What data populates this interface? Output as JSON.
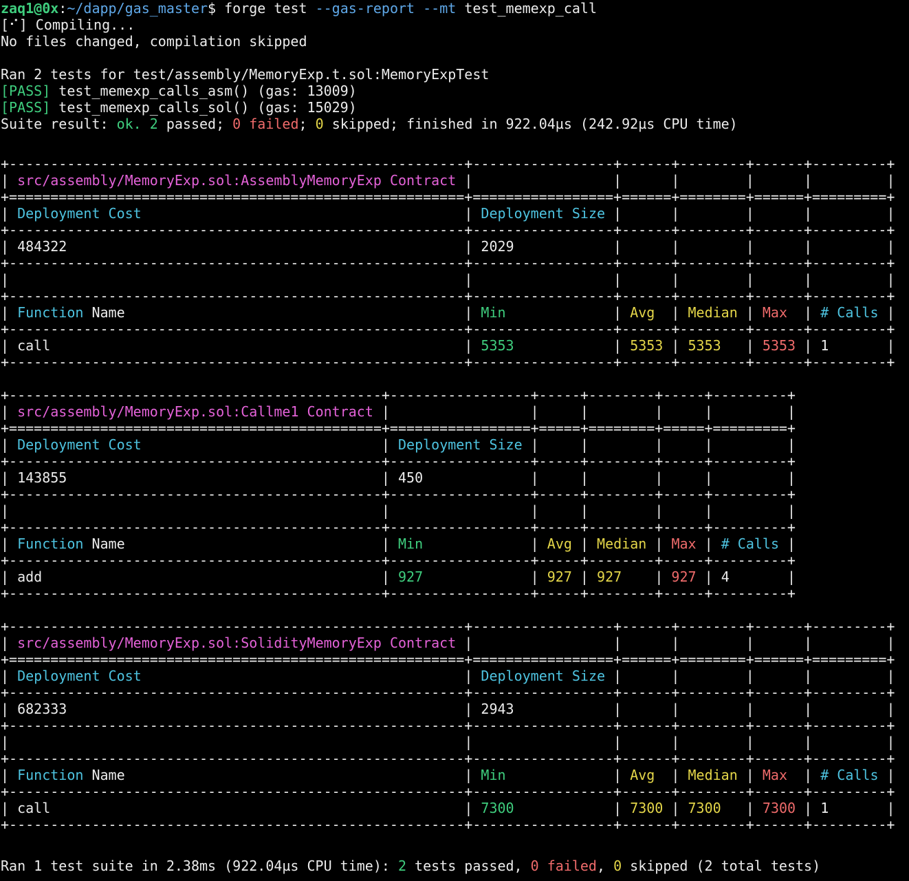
{
  "prompt": {
    "user_host": "zaq1@0x",
    "path": "~/dapp/gas_master",
    "symbol": "$ ",
    "cmd": "forge test ",
    "flag1": "--gas-report",
    "space": " ",
    "flag2": "--mt",
    "arg": " test_memexp_call"
  },
  "compile_line": "[⠊] Compiling...",
  "nochange_line": "No files changed, compilation skipped",
  "ran_line": "Ran 2 tests for test/assembly/MemoryExp.t.sol:MemoryExpTest",
  "tests": [
    {
      "status": "[PASS]",
      "text": " test_memexp_calls_asm() (gas: 13009)"
    },
    {
      "status": "[PASS]",
      "text": " test_memexp_calls_sol() (gas: 15029)"
    }
  ],
  "suite_result": {
    "prefix": "Suite result: ",
    "ok": "ok.",
    "sp1": " ",
    "passed_n": "2",
    "passed_t": " passed; ",
    "failed_n": "0",
    "failed_t": " failed",
    "sep": "; ",
    "skipped_n": "0",
    "skipped_t": " skipped; finished in 922.04µs (242.92µs CPU time)"
  },
  "headers": {
    "dep_cost": "Deployment Cost",
    "dep_size": "Deployment Size",
    "fn_function": "Function",
    "fn_name": "Name",
    "min": "Min",
    "avg": "Avg",
    "median": "Median",
    "max": "Max",
    "calls": "# Calls"
  },
  "reports": [
    {
      "contract_title": "src/assembly/MemoryExp.sol:AssemblyMemoryExp Contract",
      "deployment_cost": "484322",
      "deployment_size": "2029",
      "functions": [
        {
          "name": "call",
          "min": "5353",
          "avg": "5353",
          "median": "5353",
          "max": "5353",
          "calls": "1"
        }
      ]
    },
    {
      "contract_title": "src/assembly/MemoryExp.sol:Callme1 Contract",
      "deployment_cost": "143855",
      "deployment_size": "450",
      "functions": [
        {
          "name": "add",
          "min": "927",
          "avg": "927",
          "median": "927",
          "max": "927",
          "calls": "4"
        }
      ]
    },
    {
      "contract_title": "src/assembly/MemoryExp.sol:SolidityMemoryExp Contract",
      "deployment_cost": "682333",
      "deployment_size": "2943",
      "functions": [
        {
          "name": "call",
          "min": "7300",
          "avg": "7300",
          "median": "7300",
          "max": "7300",
          "calls": "1"
        }
      ]
    }
  ],
  "final": {
    "prefix": "Ran 1 test suite in 2.38ms (922.04µs CPU time): ",
    "passed_n": "2",
    "passed_t": " tests passed, ",
    "failed_n": "0",
    "failed_t": " failed",
    "sep": ", ",
    "skipped_n": "0",
    "skipped_t": " skipped (2 total tests)"
  }
}
